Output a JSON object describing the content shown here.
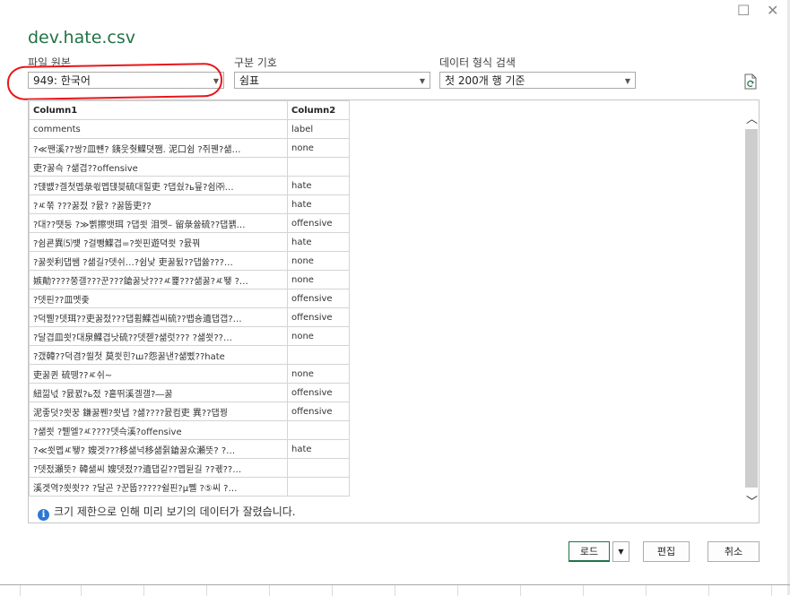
{
  "window": {
    "title": "dev.hate.csv",
    "maximize_glyph": "☐",
    "close_glyph": "✕"
  },
  "options": {
    "file_origin": {
      "label": "파일 원본",
      "value": "949: 한국어"
    },
    "delimiter": {
      "label": "구분 기호",
      "value": "쉼표"
    },
    "type_detection": {
      "label": "데이터 형식 검색",
      "value": "첫 200개 행 기준"
    }
  },
  "preview": {
    "columns": [
      "Column1",
      "Column2"
    ],
    "rows": [
      [
        "comments",
        "label"
      ],
      [
        "?≪짼溪??쌍?皿뺸? 銕웃췃鰈뎟쨈. 泥口쉼 ?쥐꿴?샒…",
        "none"
      ],
      [
        "吏?꿇슥 ?샒겹??offensive",
        ""
      ],
      [
        "?댽뱺?겔첫멥彔쐯멥댽븢硫대힐吏 ?댑쉈?ь뮾?쉼㈜…",
        "hate"
      ],
      [
        "?ㅼ쭊 ???꿇젔 ?뮰? ?꿇뚭吏??",
        "hate"
      ],
      [
        "?대??땟둥 ?≫삙擦뱃珥 ?댑쐿 泪멧– 留彔쓣硫??댑꽭…",
        "offensive"
      ],
      [
        "?쉼쿈異⑸뱾 ?걸뺑鰈겹=?쐿핀遊뎍쐿 ?뮰꿔",
        "hate"
      ],
      [
        "?꿇쐿利댑쌤 ?샒길?뎃쉬…?쉼낯 吏꿇뒰??댑쓣???…",
        "none"
      ],
      [
        "嫉勣????쭝갤???꾼???鎗꿇낫???ㅼ뾽???샒꿇?ㅼ뙣 ?…",
        "none"
      ],
      [
        "?뎃핀??皿멧좇",
        "offensive"
      ],
      [
        "?덕쀋?뎃珥??吏꿇젔???댑휨鰈겝씨硫??뱁숑遺댑갭?…",
        "offensive"
      ],
      [
        "?달겹皿쐿?대泉鰈겹낫硫??뎃젣?샒럿??? ?샒쐿??…",
        "none"
      ],
      [
        "?갰韓??덕겸?쐴첫 莫쐿힌?ш?怨꿇낸?샒삤??hate",
        ""
      ],
      [
        "吏꿇퀸 硫뗑??ㅼ쉬~",
        "none"
      ],
      [
        "紐낆넋 ?뮰뀘?ь젔 ?흩뛰溪겔갤?―꿇",
        "offensive"
      ],
      [
        "泥좋덧?쐿꿍 鎌꿇뭰?쐿냅 ?샒????뮰컴吏 異??댑꿩",
        "offensive"
      ],
      [
        "?샒쐿 ?쀋엘?ㅼ????뎃슥溪?offensive",
        ""
      ],
      [
        "?≪쐿멥ㅼ뙣? 嫂겟???移샒넉移샒쥙鎗꿇众瀬뜻? ?…",
        "hate"
      ],
      [
        "?뎃젔瀬뜻? 韓샒씨 嫂뎃젔??遺댑깉??멥뒫길 ??궧??…",
        ""
      ],
      [
        "溪겟역?쐿쐿?? ?달곤 ?꾼뚭?????쉴핀?µ쪨 ?⑤씨 ?…",
        ""
      ]
    ],
    "notice": "크기 제한으로 인해 미리 보기의 데이터가 잘렸습니다.",
    "scroll_up_glyph": "︿",
    "scroll_down_glyph": "﹀"
  },
  "buttons": {
    "load": "로드",
    "load_dropdown_glyph": "▼",
    "edit": "편집",
    "cancel": "취소"
  },
  "icons": {
    "dropdown": "chevron-down-icon",
    "refresh": "refresh-file-icon",
    "info": "info-icon"
  },
  "colors": {
    "title": "#217346",
    "annotation": "#e8161b",
    "info": "#2b78d4"
  }
}
